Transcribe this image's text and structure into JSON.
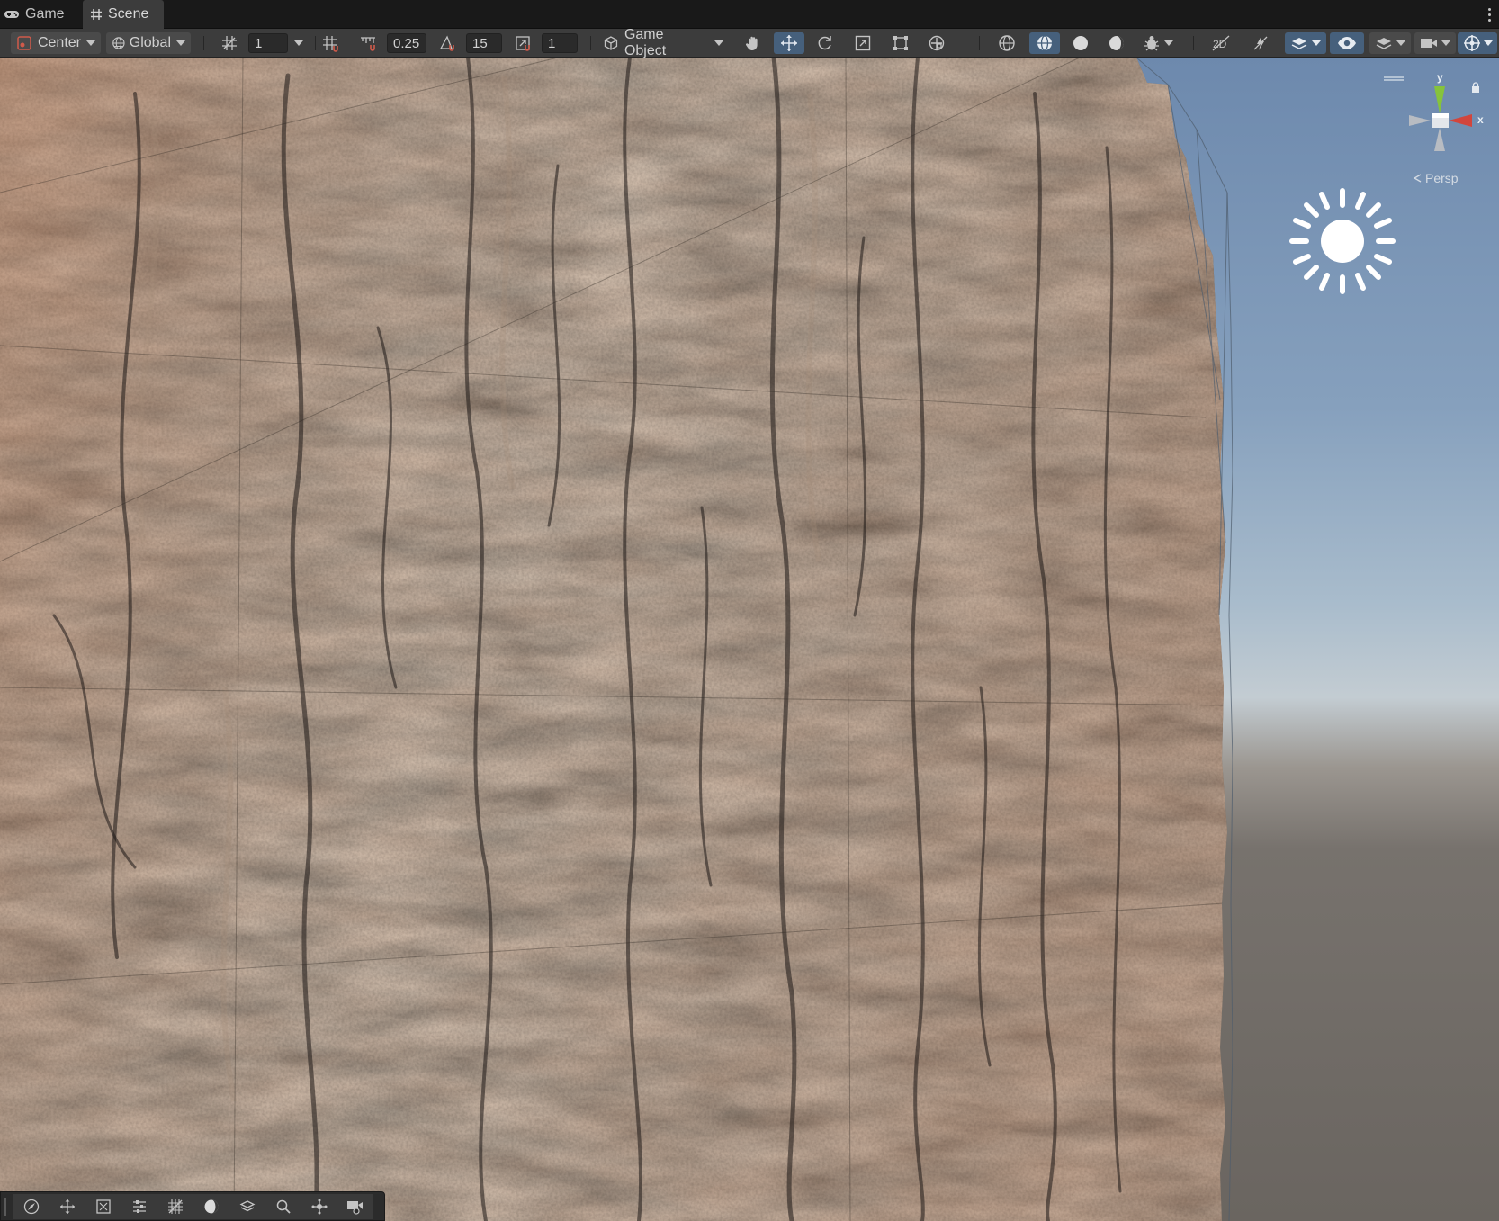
{
  "tabs": [
    {
      "label": "Game",
      "icon": "gamepad-icon",
      "active": false
    },
    {
      "label": "Scene",
      "icon": "hash-icon",
      "active": true
    }
  ],
  "toolbar": {
    "pivot_label": "Center",
    "space_label": "Global",
    "grid_size": "1",
    "snap_increment": "0.25",
    "rotate_snap": "15",
    "scale_snap": "1",
    "object_mode_label": "Game Object"
  },
  "gizmo": {
    "projection_label": "Persp",
    "axis_y": "y",
    "axis_x": "x"
  },
  "colors": {
    "active_tool": "#46607c",
    "toolbar_bg": "#3c3c3c",
    "tabbar_bg": "#191919",
    "axis_y": "#86c33b",
    "axis_x": "#d2453c"
  },
  "overlay_tools": [
    "compass-icon",
    "move-arrows-icon",
    "rect-select-icon",
    "sliders-icon",
    "grid-icon",
    "shading-icon",
    "layers-icon",
    "search-icon",
    "snap-icon",
    "camera-icon"
  ]
}
